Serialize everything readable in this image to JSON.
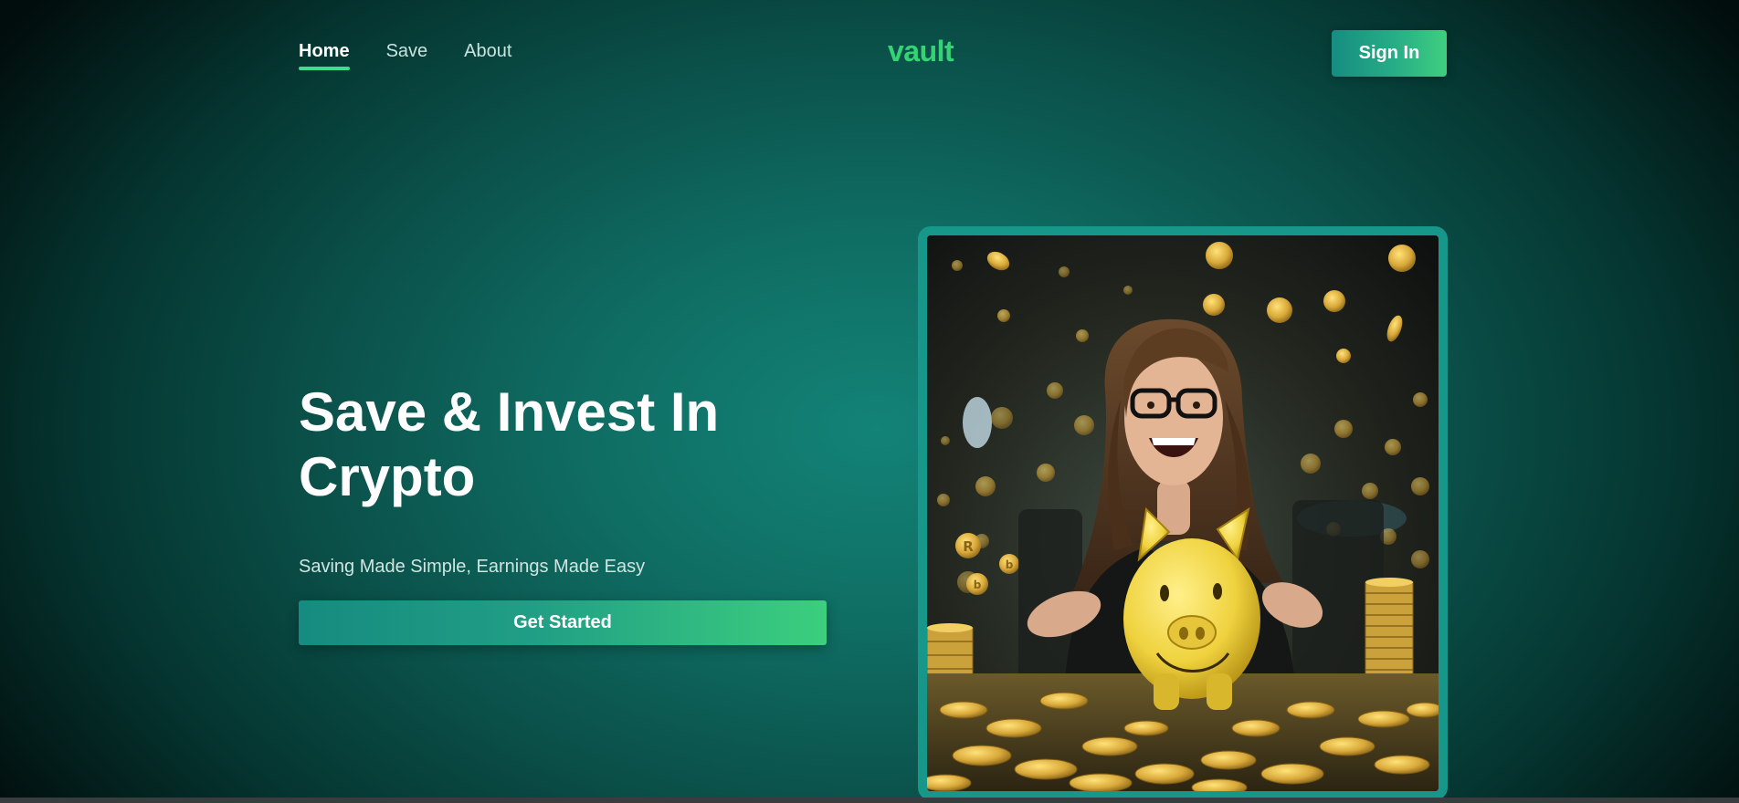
{
  "nav": {
    "items": [
      {
        "label": "Home",
        "active": true
      },
      {
        "label": "Save",
        "active": false
      },
      {
        "label": "About",
        "active": false
      }
    ]
  },
  "brand": {
    "logo_text": "vault",
    "accent_color": "#34d474",
    "primary_color": "#17978a"
  },
  "header": {
    "signin_label": "Sign In"
  },
  "hero": {
    "title": "Save & Invest In Crypto",
    "subtitle": "Saving Made Simple, Earnings Made Easy",
    "cta_label": "Get Started",
    "image_alt": "Smiling woman with glasses holding a golden piggy bank surrounded by falling gold crypto coins"
  }
}
